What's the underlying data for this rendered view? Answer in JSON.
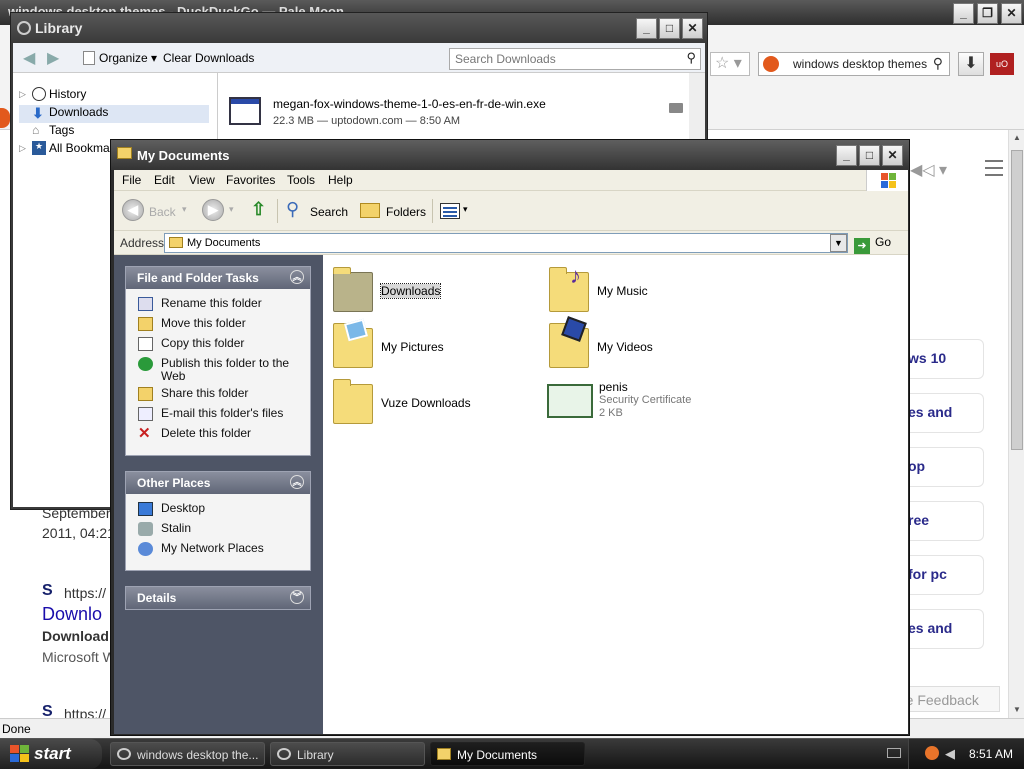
{
  "browser": {
    "title": "windows desktop themes - DuckDuckGo — Pale Moon",
    "search_value": "windows desktop themes",
    "status": "Done",
    "feedback": "re Feedback",
    "cards": [
      "ws 10",
      "es and",
      "op",
      "ree",
      "for pc",
      "es and"
    ],
    "result_date_1": "September",
    "result_date_2": "2011, 04:21",
    "result_url_1": "https://",
    "result_link": "Downlo",
    "result_snippet_1": "Download",
    "result_snippet_2": "Microsoft W",
    "result_url_2": "https://"
  },
  "library": {
    "title": "Library",
    "organize": "Organize",
    "clear_downloads": "Clear Downloads",
    "search_placeholder": "Search Downloads",
    "tree": [
      "History",
      "Downloads",
      "Tags",
      "All Bookmarks"
    ],
    "download": {
      "name": "megan-fox-windows-theme-1-0-es-en-fr-de-win.exe",
      "meta": "22.3 MB — uptodown.com — 8:50 AM"
    }
  },
  "mydocs": {
    "title": "My Documents",
    "menu": [
      "File",
      "Edit",
      "View",
      "Favorites",
      "Tools",
      "Help"
    ],
    "toolbar": {
      "back": "Back",
      "search": "Search",
      "folders": "Folders"
    },
    "address_label": "Address",
    "address_value": "My Documents",
    "go": "Go",
    "tasks": {
      "file_folder_title": "File and Folder Tasks",
      "file_folder_items": [
        "Rename this folder",
        "Move this folder",
        "Copy this folder",
        "Publish this folder to the Web",
        "Share this folder",
        "E-mail this folder's files",
        "Delete this folder"
      ],
      "other_title": "Other Places",
      "other_items": [
        "Desktop",
        "Stalin",
        "My Network Places"
      ],
      "details_title": "Details"
    },
    "items": [
      {
        "name": "Downloads"
      },
      {
        "name": "My Music"
      },
      {
        "name": "My Pictures"
      },
      {
        "name": "My Videos"
      },
      {
        "name": "Vuze Downloads"
      },
      {
        "name": "penis",
        "type": "Security Certificate",
        "size": "2 KB"
      }
    ]
  },
  "taskbar": {
    "start": "start",
    "buttons": [
      "windows desktop the...",
      "Library",
      "My Documents"
    ],
    "clock": "8:51 AM"
  },
  "colors": {
    "title_dark": "#3a3a3a",
    "task_pane": "#4e5566",
    "folder": "#f5dc7a",
    "link": "#1a0dab"
  }
}
